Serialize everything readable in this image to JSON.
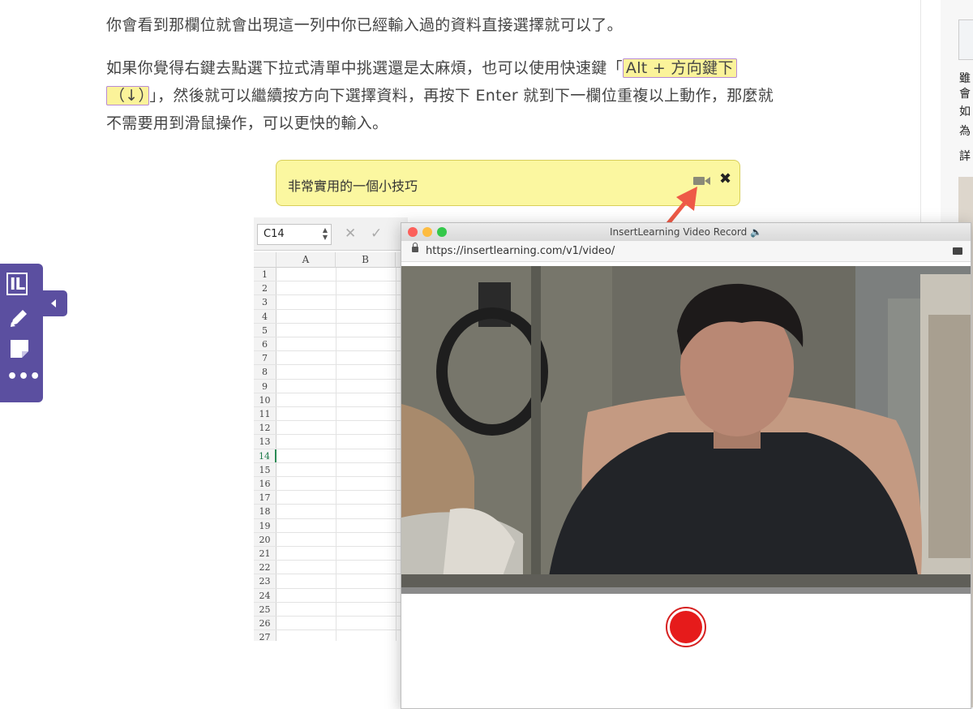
{
  "article": {
    "para1": "你會看到那欄位就會出現這一列中你已經輸入過的資料直接選擇就可以了。",
    "para2_before": "如果你覺得右鍵去點選下拉式清單中挑選還是太麻煩，也可以使用快速鍵「",
    "para2_hl1": "Alt + 方向鍵下",
    "para2_hl2": "（↓）",
    "para2_after1": "」，然後就可以繼續按方向下選擇資料，再按下 Enter 就到下一欄位重複以上動作，那麼就",
    "para2_after2": "不需要用到滑鼠操作，可以更快的輸入。"
  },
  "right_column": {
    "lines": [
      "雖",
      "會",
      "如",
      "為",
      "詳"
    ]
  },
  "note": {
    "text": "非常實用的一個小技巧",
    "camera_icon": "video-camera-icon",
    "close_label": "✖"
  },
  "toolbar": {
    "logo": "IL",
    "items": [
      "il-logo-icon",
      "pencil-icon",
      "sticky-note-icon",
      "more-icon"
    ],
    "more_label": "•••"
  },
  "spreadsheet": {
    "name_box": "C14",
    "cancel_label": "✕",
    "confirm_label": "✓",
    "columns": [
      "A",
      "B"
    ],
    "rows": [
      "1",
      "2",
      "3",
      "4",
      "5",
      "6",
      "7",
      "8",
      "9",
      "10",
      "11",
      "12",
      "13",
      "14",
      "15",
      "16",
      "17",
      "18",
      "19",
      "20",
      "21",
      "22",
      "23",
      "24",
      "25",
      "26",
      "27"
    ],
    "active_row": "14"
  },
  "video_window": {
    "title": "InsertLearning Video Record 🔈",
    "url": "https://insertlearning.com/v1/video/"
  },
  "colors": {
    "toolbar": "#5b4fa0",
    "note_bg": "#fbf7a0",
    "highlight": "#fbf39a",
    "record": "#e61b1b",
    "arrow": "#ee5a47"
  }
}
